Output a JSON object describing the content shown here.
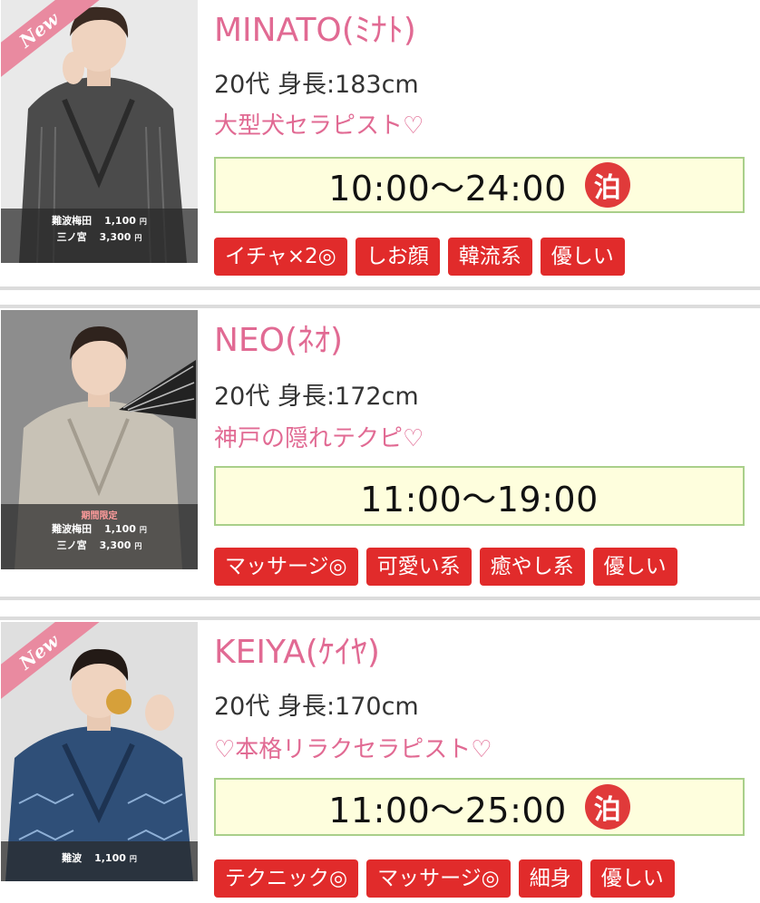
{
  "cards": [
    {
      "name": "MINATO(ﾐﾅﾄ)",
      "spec": "20代 身長:183cm",
      "catch": "大型犬セラピスト♡",
      "time": "10:00〜24:00",
      "stay_badge": "泊",
      "new_badge": "New",
      "tags": [
        "イチャ×2◎",
        "しお顔",
        "韓流系",
        "優しい"
      ],
      "prices": [
        {
          "area": "難波梅田",
          "price": "1,100",
          "unit": "円"
        },
        {
          "area": "三ノ宮",
          "price": "3,300",
          "unit": "円"
        }
      ]
    },
    {
      "name": "NEO(ﾈｵ)",
      "spec": "20代 身長:172cm",
      "catch": "神戸の隠れテクピ♡",
      "time": "11:00〜19:00",
      "limited": "期間限定",
      "tags": [
        "マッサージ◎",
        "可愛い系",
        "癒やし系",
        "優しい"
      ],
      "prices": [
        {
          "area": "難波梅田",
          "price": "1,100",
          "unit": "円"
        },
        {
          "area": "三ノ宮",
          "price": "3,300",
          "unit": "円"
        }
      ]
    },
    {
      "name": "KEIYA(ｹｲﾔ)",
      "spec": "20代 身長:170cm",
      "catch": "♡本格リラクセラピスト♡",
      "time": "11:00〜25:00",
      "stay_badge": "泊",
      "new_badge": "New",
      "tags": [
        "テクニック◎",
        "マッサージ◎",
        "細身",
        "優しい"
      ],
      "prices": [
        {
          "area": "難波",
          "price": "1,100",
          "unit": "円"
        }
      ]
    }
  ],
  "colors": {
    "name_pink": "#e16a93",
    "tag_red": "#e12b2b",
    "time_bg": "#fefedd",
    "time_border": "#a9cf8a",
    "new_ribbon": "#e98aa0"
  }
}
